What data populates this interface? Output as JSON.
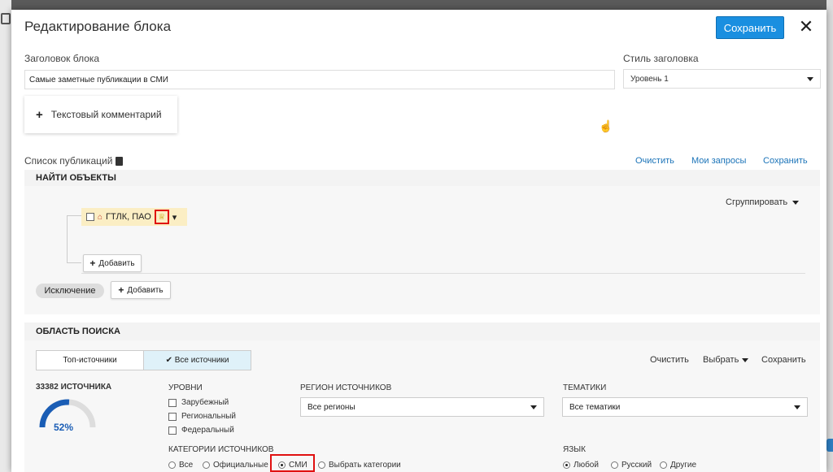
{
  "modal": {
    "title": "Редактирование блока",
    "save_label": "Сохранить",
    "close_glyph": "✕"
  },
  "block_title": {
    "label": "Заголовок блока",
    "value": "Самые заметные публикации в СМИ"
  },
  "heading_style": {
    "label": "Стиль заголовка",
    "value": "Уровень 1"
  },
  "comment_button": {
    "plus": "+",
    "label": "Текстовый комментарий"
  },
  "publications": {
    "label": "Список публикаций",
    "links": {
      "clear": "Очистить",
      "my_queries": "Мои запросы",
      "save": "Сохранить"
    }
  },
  "find_objects": {
    "header": "НАЙТИ ОБЪЕКТЫ",
    "group_label": "Сгруппировать",
    "object_chip": {
      "name": "ГТЛК, ПАО",
      "house_glyph": "⌂",
      "crown_glyph": "♕",
      "caret_glyph": "▾"
    },
    "add_label": "Добавить",
    "add_plus": "+",
    "exclusion_label": "Исключение"
  },
  "search_area": {
    "header": "ОБЛАСТЬ ПОИСКА",
    "tabs": [
      {
        "label": "Топ-источники"
      },
      {
        "label": "✔ Все источники"
      }
    ],
    "links": {
      "clear": "Очистить",
      "choose": "Выбрать",
      "save": "Сохранить"
    },
    "source_count": "33382 ИСТОЧНИКА",
    "gauge_percent": 52,
    "gauge_label": "52%",
    "levels": {
      "header": "УРОВНИ",
      "items": [
        "Зарубежный",
        "Региональный",
        "Федеральный"
      ]
    },
    "region": {
      "header": "РЕГИОН ИСТОЧНИКОВ",
      "value": "Все регионы"
    },
    "topics": {
      "header": "ТЕМАТИКИ",
      "value": "Все тематики"
    },
    "categories": {
      "header": "КАТЕГОРИИ ИСТОЧНИКОВ",
      "options": [
        "Все",
        "Официальные",
        "СМИ",
        "Выбрать категории"
      ],
      "selected": "СМИ"
    },
    "language": {
      "header": "ЯЗЫК",
      "options": [
        "Любой",
        "Русский",
        "Другие"
      ],
      "selected": "Любой"
    }
  },
  "colors": {
    "accent": "#1a8fe0",
    "link": "#1a73b8",
    "highlight": "#e01010",
    "chip": "#fbeec4"
  }
}
